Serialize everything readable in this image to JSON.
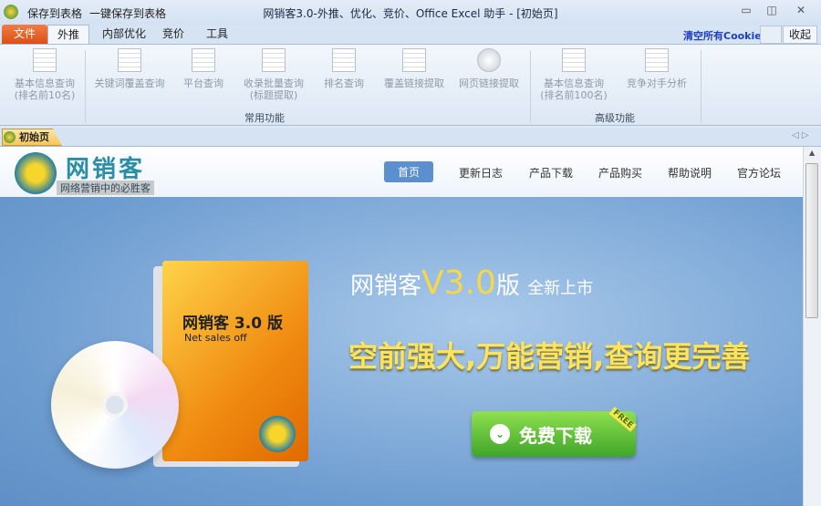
{
  "titlebar": {
    "quick_save": "保存到表格",
    "quick_save_all": "一键保存到表格",
    "title": "网销客3.0-外推、优化、竞价、Office Excel 助手 - [初始页]"
  },
  "tabs": [
    {
      "label": "文件"
    },
    {
      "label": "外推"
    },
    {
      "label": "内部优化"
    },
    {
      "label": "竞价"
    },
    {
      "label": "工具"
    }
  ],
  "right_actions": {
    "clear_cookie": "清空所有Cookie",
    "collapse": "收起"
  },
  "ribbon": {
    "common": [
      {
        "l1": "基本信息查询",
        "l2": "(排名前10名)"
      },
      {
        "l1": "关键词覆盖查询",
        "l2": ""
      },
      {
        "l1": "平台查询",
        "l2": ""
      },
      {
        "l1": "收录批量查询",
        "l2": "(标题提取)"
      },
      {
        "l1": "排名查询",
        "l2": ""
      },
      {
        "l1": "覆盖链接提取",
        "l2": ""
      },
      {
        "l1": "网页链接提取",
        "l2": ""
      }
    ],
    "common_group": "常用功能",
    "advanced": [
      {
        "l1": "基本信息查询",
        "l2": "(排名前100名)"
      },
      {
        "l1": "竞争对手分析",
        "l2": ""
      }
    ],
    "advanced_group": "高级功能"
  },
  "doc_tab": "初始页",
  "site": {
    "logo": "网销客",
    "slogan": "网络营销中的必胜客",
    "nav": [
      "首页",
      "更新日志",
      "产品下载",
      "产品购买",
      "帮助说明",
      "官方论坛"
    ],
    "box_title": "网销客 3.0 版",
    "box_sub": "Net sales off",
    "headline_a": "网销客",
    "headline_v": "V3.0",
    "headline_b": "版",
    "headline_c": "全新上市",
    "tagline": "空前强大,万能营销,查询更完善",
    "download": "免费下载",
    "free": "FREE"
  }
}
